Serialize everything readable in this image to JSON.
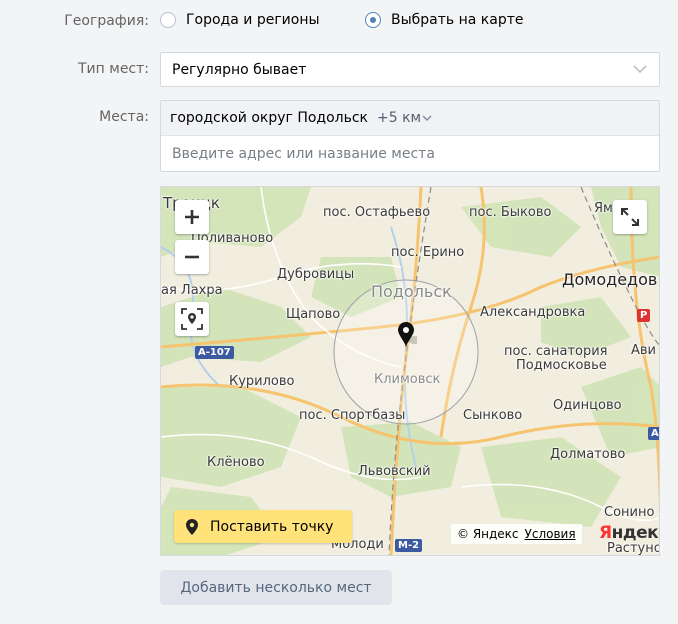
{
  "geography": {
    "label": "География:",
    "options": [
      {
        "label": "Города и регионы",
        "selected": false
      },
      {
        "label": "Выбрать на карте",
        "selected": true
      }
    ]
  },
  "place_type": {
    "label": "Тип мест:",
    "value": "Регулярно бывает"
  },
  "places": {
    "label": "Места:",
    "selected_place": "городской округ Подольск",
    "radius": "+5 км",
    "input_placeholder": "Введите адрес или название места"
  },
  "map": {
    "labels": {
      "troitsk": "Троицк",
      "ostafyevo": "пос. Остафьево",
      "bykovo": "пос. Быково",
      "yam": "Ям",
      "polivanovo": "Поливаново",
      "dubrovitsy": "Дубровицы",
      "erino": "пос. Ерино",
      "domodedovo": "Домодедов",
      "lakhra": "ая Лахра",
      "podolsk": "Подольск",
      "shchapovo": "Щапово",
      "aleksandrovka": "Александровка",
      "avi": "Ави",
      "kurilovo": "Курилово",
      "sanatorium_1": "пос. санатория",
      "sanatorium_2": "Подмосковье",
      "klimovsk": "Климовск",
      "sportbazy": "пос. Спортбазы",
      "synkovo": "Сынково",
      "odintsovo": "Одинцово",
      "klenovo": "Клёново",
      "dolmatovo": "Долматово",
      "lvovsky": "Львовский",
      "sonino": "Сонино",
      "molodi": "Молоди",
      "rastunovo": "Растуно"
    },
    "highways": {
      "a107": "А-107",
      "m2": "М-2",
      "a_right": "А",
      "a_top": "Р"
    },
    "put_point_label": "Поставить точку",
    "attribution": "© Яндекс",
    "terms_link": "Условия",
    "logo_ya": "Я",
    "logo_rest": "ндекс",
    "accent_color": "#5181b8",
    "button_yellow": "#ffe27a"
  },
  "add_multiple_button": "Добавить несколько мест"
}
